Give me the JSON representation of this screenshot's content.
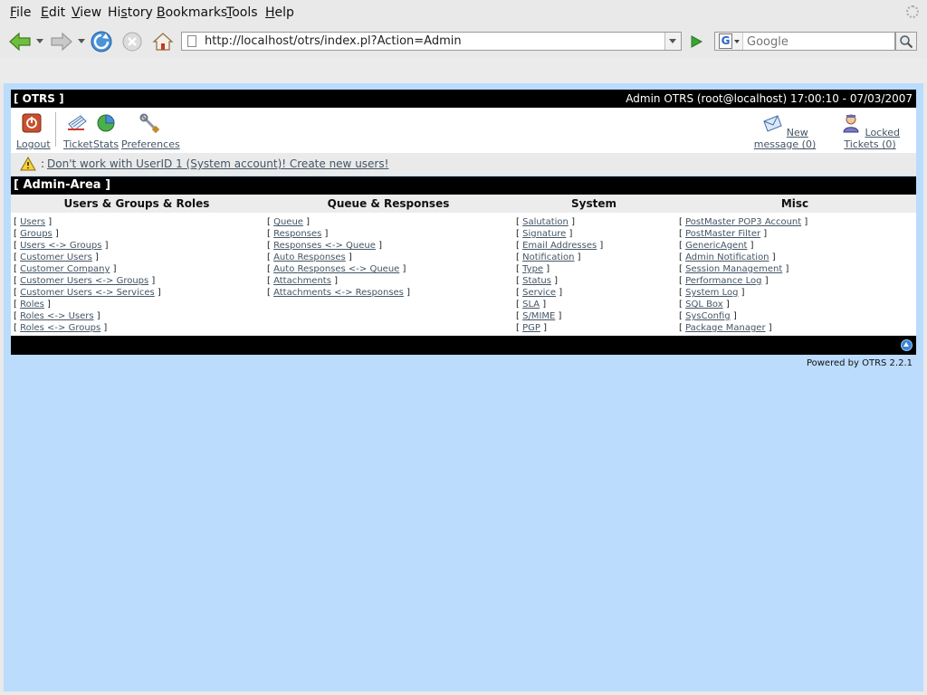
{
  "menubar": {
    "items": [
      {
        "accel": "F",
        "rest": "ile"
      },
      {
        "accel": "E",
        "rest": "dit"
      },
      {
        "accel": "V",
        "rest": "iew"
      },
      {
        "accel": "",
        "pre": "Hi",
        "accel2": "s",
        "rest": "tory"
      },
      {
        "accel": "B",
        "rest": "ookmarks"
      },
      {
        "accel": "T",
        "rest": "ools"
      },
      {
        "accel": "H",
        "rest": "elp"
      }
    ],
    "labels": [
      "File",
      "Edit",
      "View",
      "History",
      "Bookmarks",
      "Tools",
      "Help"
    ]
  },
  "navigation": {
    "url": "http://localhost/otrs/index.pl?Action=Admin",
    "search_placeholder": "Google",
    "search_engine_glyph": "G"
  },
  "otrs": {
    "brand": "[ OTRS ]",
    "user_info": "Admin OTRS (root@localhost) 17:00:10 - 07/03/2007",
    "nav_left": [
      {
        "label": "Logout",
        "icon": "power-icon"
      },
      {
        "label": "Ticket",
        "icon": "ticket-icon"
      },
      {
        "label": "Stats",
        "icon": "pie-chart-icon"
      },
      {
        "label": "Preferences",
        "icon": "wrench-icon"
      }
    ],
    "nav_right": [
      {
        "label": "New message (0)",
        "icon": "envelope-icon"
      },
      {
        "label": "Locked Tickets (0)",
        "icon": "agent-icon"
      }
    ],
    "notice_colon": ":",
    "notice_link": "Don't work with UserID 1 (System account)! Create new users!",
    "section_title": "[ Admin-Area ]",
    "columns": [
      {
        "title": "Users & Groups & Roles",
        "links": [
          "Users",
          "Groups",
          "Users <-> Groups",
          "Customer Users",
          "Customer Company",
          "Customer Users <-> Groups",
          "Customer Users <-> Services",
          "Roles",
          "Roles <-> Users",
          "Roles <-> Groups"
        ]
      },
      {
        "title": "Queue & Responses",
        "links": [
          "Queue",
          "Responses",
          "Responses <-> Queue",
          "Auto Responses",
          "Auto Responses <-> Queue",
          "Attachments",
          "Attachments <-> Responses"
        ]
      },
      {
        "title": "System",
        "links": [
          "Salutation",
          "Signature",
          "Email Addresses",
          "Notification",
          "Type",
          "Status",
          "Service",
          "SLA",
          "S/MIME",
          "PGP"
        ]
      },
      {
        "title": "Misc",
        "links": [
          "PostMaster POP3 Account",
          "PostMaster Filter",
          "GenericAgent",
          "Admin Notification",
          "Session Management",
          "Performance Log",
          "System Log",
          "SQL Box",
          "SysConfig",
          "Package Manager"
        ]
      }
    ],
    "powered_by": "Powered by OTRS 2.2.1"
  },
  "colors": {
    "viewport_bg": "#bbdcfc",
    "bar_black": "#000000",
    "link": "#445566"
  }
}
